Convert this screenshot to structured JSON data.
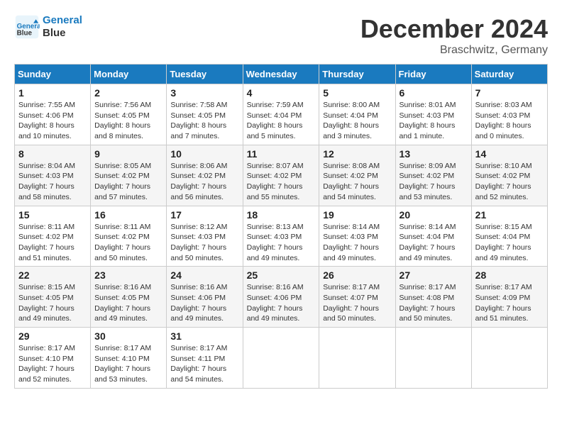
{
  "header": {
    "logo_line1": "General",
    "logo_line2": "Blue",
    "month": "December 2024",
    "location": "Braschwitz, Germany"
  },
  "weekdays": [
    "Sunday",
    "Monday",
    "Tuesday",
    "Wednesday",
    "Thursday",
    "Friday",
    "Saturday"
  ],
  "weeks": [
    [
      {
        "day": "1",
        "sunrise": "Sunrise: 7:55 AM",
        "sunset": "Sunset: 4:06 PM",
        "daylight": "Daylight: 8 hours and 10 minutes."
      },
      {
        "day": "2",
        "sunrise": "Sunrise: 7:56 AM",
        "sunset": "Sunset: 4:05 PM",
        "daylight": "Daylight: 8 hours and 8 minutes."
      },
      {
        "day": "3",
        "sunrise": "Sunrise: 7:58 AM",
        "sunset": "Sunset: 4:05 PM",
        "daylight": "Daylight: 8 hours and 7 minutes."
      },
      {
        "day": "4",
        "sunrise": "Sunrise: 7:59 AM",
        "sunset": "Sunset: 4:04 PM",
        "daylight": "Daylight: 8 hours and 5 minutes."
      },
      {
        "day": "5",
        "sunrise": "Sunrise: 8:00 AM",
        "sunset": "Sunset: 4:04 PM",
        "daylight": "Daylight: 8 hours and 3 minutes."
      },
      {
        "day": "6",
        "sunrise": "Sunrise: 8:01 AM",
        "sunset": "Sunset: 4:03 PM",
        "daylight": "Daylight: 8 hours and 1 minute."
      },
      {
        "day": "7",
        "sunrise": "Sunrise: 8:03 AM",
        "sunset": "Sunset: 4:03 PM",
        "daylight": "Daylight: 8 hours and 0 minutes."
      }
    ],
    [
      {
        "day": "8",
        "sunrise": "Sunrise: 8:04 AM",
        "sunset": "Sunset: 4:03 PM",
        "daylight": "Daylight: 7 hours and 58 minutes."
      },
      {
        "day": "9",
        "sunrise": "Sunrise: 8:05 AM",
        "sunset": "Sunset: 4:02 PM",
        "daylight": "Daylight: 7 hours and 57 minutes."
      },
      {
        "day": "10",
        "sunrise": "Sunrise: 8:06 AM",
        "sunset": "Sunset: 4:02 PM",
        "daylight": "Daylight: 7 hours and 56 minutes."
      },
      {
        "day": "11",
        "sunrise": "Sunrise: 8:07 AM",
        "sunset": "Sunset: 4:02 PM",
        "daylight": "Daylight: 7 hours and 55 minutes."
      },
      {
        "day": "12",
        "sunrise": "Sunrise: 8:08 AM",
        "sunset": "Sunset: 4:02 PM",
        "daylight": "Daylight: 7 hours and 54 minutes."
      },
      {
        "day": "13",
        "sunrise": "Sunrise: 8:09 AM",
        "sunset": "Sunset: 4:02 PM",
        "daylight": "Daylight: 7 hours and 53 minutes."
      },
      {
        "day": "14",
        "sunrise": "Sunrise: 8:10 AM",
        "sunset": "Sunset: 4:02 PM",
        "daylight": "Daylight: 7 hours and 52 minutes."
      }
    ],
    [
      {
        "day": "15",
        "sunrise": "Sunrise: 8:11 AM",
        "sunset": "Sunset: 4:02 PM",
        "daylight": "Daylight: 7 hours and 51 minutes."
      },
      {
        "day": "16",
        "sunrise": "Sunrise: 8:11 AM",
        "sunset": "Sunset: 4:02 PM",
        "daylight": "Daylight: 7 hours and 50 minutes."
      },
      {
        "day": "17",
        "sunrise": "Sunrise: 8:12 AM",
        "sunset": "Sunset: 4:03 PM",
        "daylight": "Daylight: 7 hours and 50 minutes."
      },
      {
        "day": "18",
        "sunrise": "Sunrise: 8:13 AM",
        "sunset": "Sunset: 4:03 PM",
        "daylight": "Daylight: 7 hours and 49 minutes."
      },
      {
        "day": "19",
        "sunrise": "Sunrise: 8:14 AM",
        "sunset": "Sunset: 4:03 PM",
        "daylight": "Daylight: 7 hours and 49 minutes."
      },
      {
        "day": "20",
        "sunrise": "Sunrise: 8:14 AM",
        "sunset": "Sunset: 4:04 PM",
        "daylight": "Daylight: 7 hours and 49 minutes."
      },
      {
        "day": "21",
        "sunrise": "Sunrise: 8:15 AM",
        "sunset": "Sunset: 4:04 PM",
        "daylight": "Daylight: 7 hours and 49 minutes."
      }
    ],
    [
      {
        "day": "22",
        "sunrise": "Sunrise: 8:15 AM",
        "sunset": "Sunset: 4:05 PM",
        "daylight": "Daylight: 7 hours and 49 minutes."
      },
      {
        "day": "23",
        "sunrise": "Sunrise: 8:16 AM",
        "sunset": "Sunset: 4:05 PM",
        "daylight": "Daylight: 7 hours and 49 minutes."
      },
      {
        "day": "24",
        "sunrise": "Sunrise: 8:16 AM",
        "sunset": "Sunset: 4:06 PM",
        "daylight": "Daylight: 7 hours and 49 minutes."
      },
      {
        "day": "25",
        "sunrise": "Sunrise: 8:16 AM",
        "sunset": "Sunset: 4:06 PM",
        "daylight": "Daylight: 7 hours and 49 minutes."
      },
      {
        "day": "26",
        "sunrise": "Sunrise: 8:17 AM",
        "sunset": "Sunset: 4:07 PM",
        "daylight": "Daylight: 7 hours and 50 minutes."
      },
      {
        "day": "27",
        "sunrise": "Sunrise: 8:17 AM",
        "sunset": "Sunset: 4:08 PM",
        "daylight": "Daylight: 7 hours and 50 minutes."
      },
      {
        "day": "28",
        "sunrise": "Sunrise: 8:17 AM",
        "sunset": "Sunset: 4:09 PM",
        "daylight": "Daylight: 7 hours and 51 minutes."
      }
    ],
    [
      {
        "day": "29",
        "sunrise": "Sunrise: 8:17 AM",
        "sunset": "Sunset: 4:10 PM",
        "daylight": "Daylight: 7 hours and 52 minutes."
      },
      {
        "day": "30",
        "sunrise": "Sunrise: 8:17 AM",
        "sunset": "Sunset: 4:10 PM",
        "daylight": "Daylight: 7 hours and 53 minutes."
      },
      {
        "day": "31",
        "sunrise": "Sunrise: 8:17 AM",
        "sunset": "Sunset: 4:11 PM",
        "daylight": "Daylight: 7 hours and 54 minutes."
      },
      null,
      null,
      null,
      null
    ]
  ]
}
